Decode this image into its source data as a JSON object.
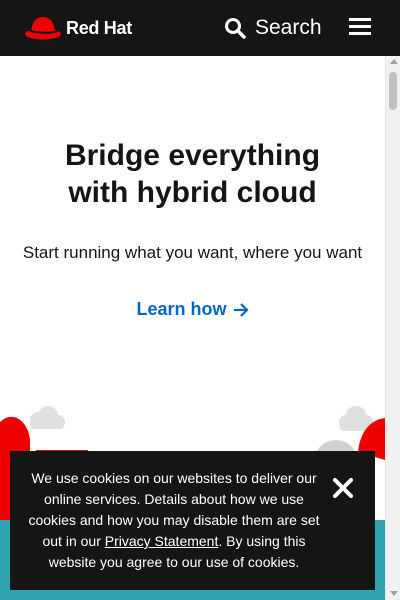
{
  "header": {
    "brand_name": "Red Hat",
    "search_label": "Search",
    "colors": {
      "background": "#151515",
      "brand_red": "#ee0000"
    },
    "icons": [
      "red-hat-logo-icon",
      "search-icon",
      "hamburger-menu-icon"
    ]
  },
  "hero": {
    "title_line1": "Bridge everything",
    "title_line2": "with hybrid cloud",
    "subtitle": "Start running what you want, where you want",
    "cta_label": "Learn how",
    "cta_icon": "arrow-right-icon",
    "cta_color": "#0066cc"
  },
  "cookie_banner": {
    "text_before_link": "We use cookies on our websites to deliver our online services. Details about how we use cookies and how you may disable them are set out in our ",
    "link_label": "Privacy Statement",
    "text_after_link": ". By using this website you agree to our use of cookies.",
    "close_icon": "close-icon"
  }
}
